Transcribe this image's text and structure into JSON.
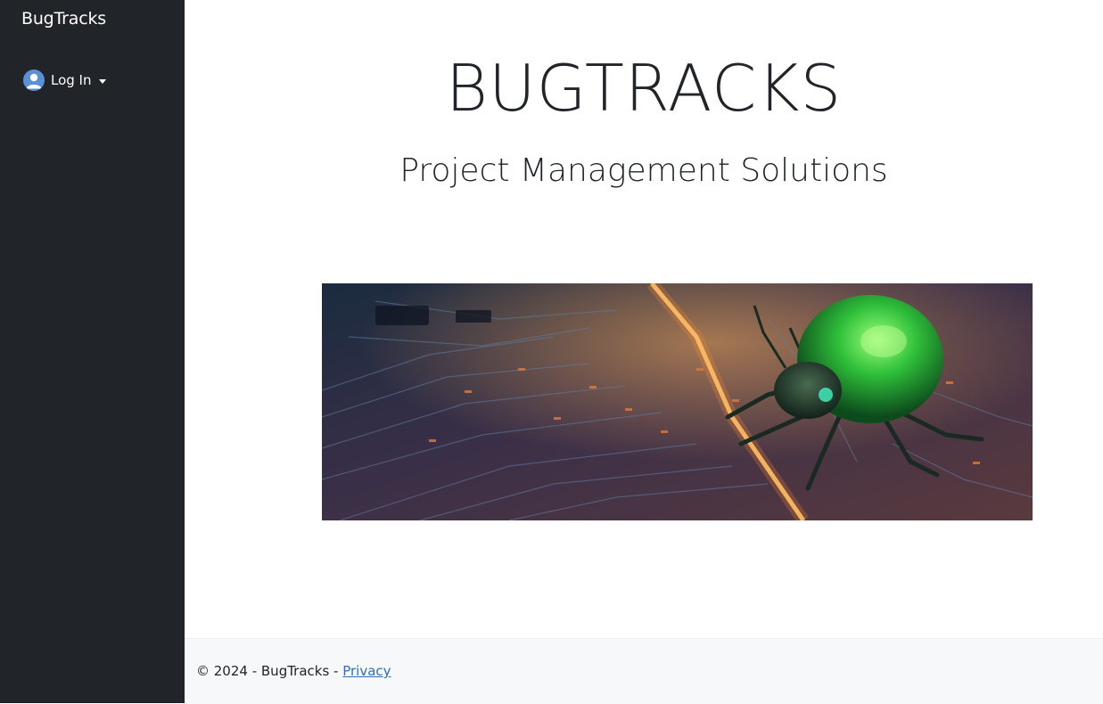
{
  "sidebar": {
    "brand": "BugTracks",
    "login_label": "Log In",
    "login_icon": "user-circle-icon",
    "login_caret_icon": "caret-down-icon"
  },
  "hero": {
    "title": "BUGTRACKS",
    "subtitle": "Project Management Solutions",
    "image_alt": "Green beetle on a glowing circuit board"
  },
  "footer": {
    "copyright": "© 2024 - BugTracks - ",
    "privacy_link": "Privacy"
  },
  "colors": {
    "sidebar_bg": "#212529",
    "avatar_blue": "#5b8fd6",
    "link": "#2f6db6",
    "footer_bg": "#f7f8f9"
  }
}
